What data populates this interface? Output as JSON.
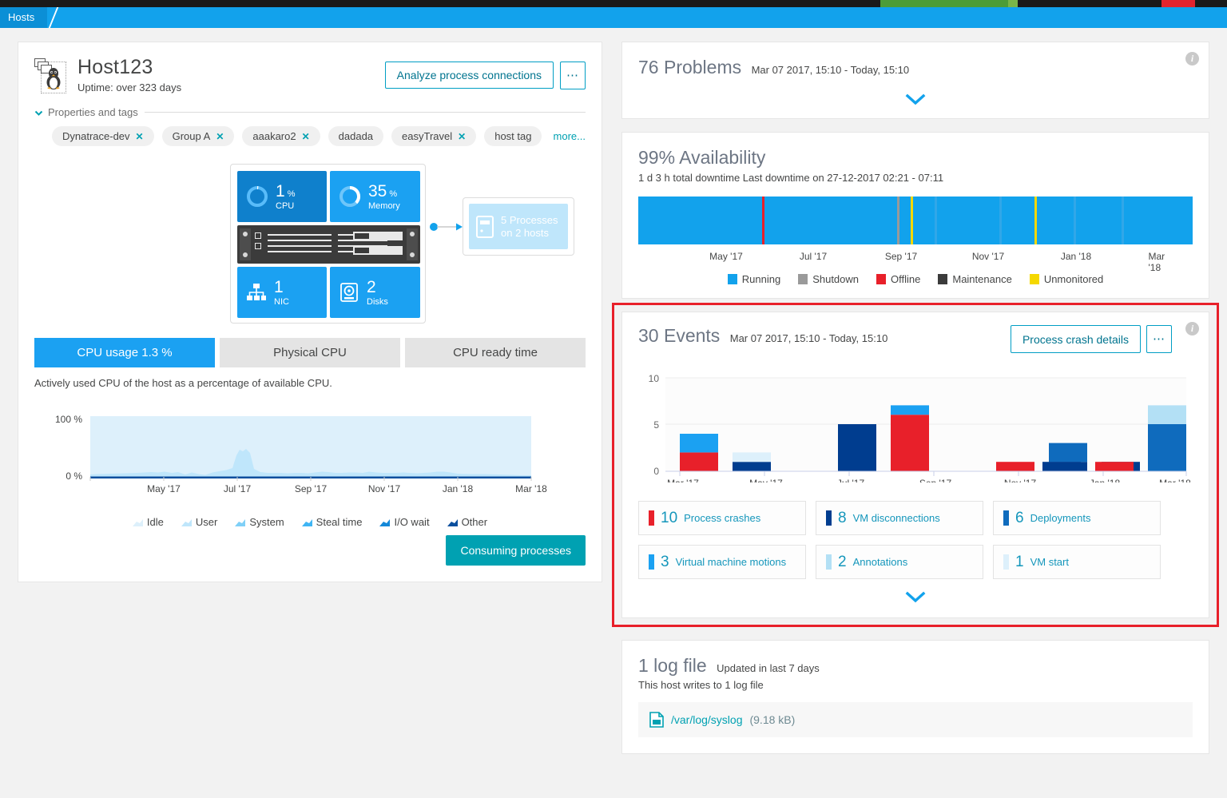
{
  "breadcrumb": {
    "label": "Hosts"
  },
  "host": {
    "name": "Host123",
    "uptime": "Uptime: over 323 days",
    "icon": "linux-penguin-icon",
    "analyze_button": "Analyze process connections",
    "more_button": "⋯",
    "properties_label": "Properties and tags",
    "more_link": "more...",
    "tags": [
      {
        "label": "Dynatrace-dev",
        "removable": true
      },
      {
        "label": "Group A",
        "removable": true
      },
      {
        "label": "aaakaro2",
        "removable": true
      },
      {
        "label": "dadada",
        "removable": false
      },
      {
        "label": "easyTravel",
        "removable": true
      },
      {
        "label": "host tag",
        "removable": false
      }
    ]
  },
  "infrastructure": {
    "cpu": {
      "value": "1",
      "unit": "%",
      "label": "CPU"
    },
    "memory": {
      "value": "35",
      "unit": "%",
      "label": "Memory"
    },
    "nic": {
      "value": "1",
      "label": "NIC"
    },
    "disks": {
      "value": "2",
      "label": "Disks"
    },
    "processes": {
      "line1": "5 Processes",
      "line2": "on 2 hosts"
    }
  },
  "cpu_tabs": {
    "items": [
      {
        "label": "CPU usage 1.3 %",
        "active": true
      },
      {
        "label": "Physical CPU",
        "active": false
      },
      {
        "label": "CPU ready time",
        "active": false
      }
    ],
    "description": "Actively used CPU of the host as a percentage of available CPU."
  },
  "consuming_processes_button": "Consuming processes",
  "problems": {
    "title": "76 Problems",
    "timerange": "Mar 07 2017, 15:10 - Today, 15:10"
  },
  "availability": {
    "title": "99% Availability",
    "subtitle": "1 d 3 h total downtime Last downtime on 27-12-2017 02:21 - 07:11",
    "legend": [
      {
        "label": "Running",
        "color": "#12a2ec"
      },
      {
        "label": "Shutdown",
        "color": "#9a9a9a"
      },
      {
        "label": "Offline",
        "color": "#e8202a"
      },
      {
        "label": "Maintenance",
        "color": "#3b3b3b"
      },
      {
        "label": "Unmonitored",
        "color": "#f5d800"
      }
    ]
  },
  "events": {
    "title": "30 Events",
    "timerange": "Mar 07 2017, 15:10 - Today, 15:10",
    "crash_button": "Process crash details",
    "more_button": "⋯",
    "chips": [
      {
        "count": "10",
        "label": "Process crashes",
        "color": "#e8202a"
      },
      {
        "count": "8",
        "label": "VM disconnections",
        "color": "#003d8f"
      },
      {
        "count": "6",
        "label": "Deployments",
        "color": "#0f6bbd"
      },
      {
        "count": "3",
        "label": "Virtual machine motions",
        "color": "#1ba1f2"
      },
      {
        "count": "2",
        "label": "Annotations",
        "color": "#b3e0f5"
      },
      {
        "count": "1",
        "label": "VM start",
        "color": "#ddf0fb"
      }
    ]
  },
  "logfile": {
    "title": "1 log file",
    "updated": "Updated in last 7 days",
    "subtitle": "This host writes to 1 log file",
    "path": "/var/log/syslog",
    "size": "(9.18 kB)"
  },
  "chart_data": [
    {
      "type": "area",
      "name": "cpu-usage-chart",
      "title": "CPU usage 1.3 %",
      "ylabel": "",
      "ylim": [
        0,
        100
      ],
      "ytick_labels": [
        "100 %",
        "0 %"
      ],
      "xtick_labels": [
        "May '17",
        "Jul '17",
        "Sep '17",
        "Nov '17",
        "Jan '18",
        "Mar '18"
      ],
      "legend": [
        {
          "name": "Idle",
          "color": "#ddf0fb"
        },
        {
          "name": "User",
          "color": "#bfe6fb"
        },
        {
          "name": "System",
          "color": "#7fd0f7"
        },
        {
          "name": "Steal time",
          "color": "#3fb5f4"
        },
        {
          "name": "I/O wait",
          "color": "#1488d8"
        },
        {
          "name": "Other",
          "color": "#0b4f9e"
        }
      ],
      "series": [
        {
          "name": "User",
          "values": [
            3,
            3,
            3,
            4,
            4,
            4,
            5,
            5,
            5,
            4,
            6,
            5,
            5,
            2,
            4,
            3,
            2,
            4,
            5,
            6,
            7,
            8,
            34,
            44,
            42,
            45,
            38,
            10,
            5,
            4,
            4,
            4,
            4,
            3,
            4,
            4,
            3,
            3,
            4,
            5,
            6,
            5,
            4,
            4,
            5,
            5,
            4,
            6,
            5,
            4,
            4,
            4,
            4,
            5,
            4,
            4,
            3,
            4,
            4,
            5,
            6,
            6,
            5,
            3,
            2,
            2
          ]
        }
      ]
    },
    {
      "type": "bar",
      "name": "events-bar-chart",
      "title": "30 Events",
      "stacked": true,
      "ylim": [
        0,
        10
      ],
      "ytick_labels": [
        "0",
        "5",
        "10"
      ],
      "xtick_labels": [
        "Mar '17",
        "May '17",
        "Jul '17",
        "Sep '17",
        "Nov '17",
        "Jan '18",
        "Mar '18"
      ],
      "categories": [
        "b1",
        "b2",
        "b3",
        "b4",
        "b5",
        "b6",
        "b7",
        "b8",
        "b9",
        "b10"
      ],
      "series": [
        {
          "name": "Process crashes",
          "color": "#e8202a",
          "values": [
            2,
            0,
            0,
            6,
            0,
            1,
            0,
            0,
            1,
            0
          ]
        },
        {
          "name": "VM disconnections",
          "color": "#003d8f",
          "values": [
            0,
            1,
            5,
            0,
            0,
            0,
            1,
            1,
            0,
            0
          ]
        },
        {
          "name": "Deployments",
          "color": "#0f6bbd",
          "values": [
            0,
            0,
            0,
            0,
            0,
            0,
            2,
            0,
            0,
            4
          ]
        },
        {
          "name": "Virtual machine motions",
          "color": "#1ba1f2",
          "values": [
            2,
            0,
            0,
            1,
            0,
            0,
            0,
            0,
            0,
            0
          ]
        },
        {
          "name": "Annotations",
          "color": "#b3e0f5",
          "values": [
            0,
            0,
            0,
            0,
            0,
            0,
            0,
            0,
            0,
            2
          ]
        },
        {
          "name": "VM start",
          "color": "#ddf0fb",
          "values": [
            0,
            1,
            0,
            0,
            0,
            0,
            0,
            0,
            0,
            0
          ]
        }
      ]
    }
  ]
}
